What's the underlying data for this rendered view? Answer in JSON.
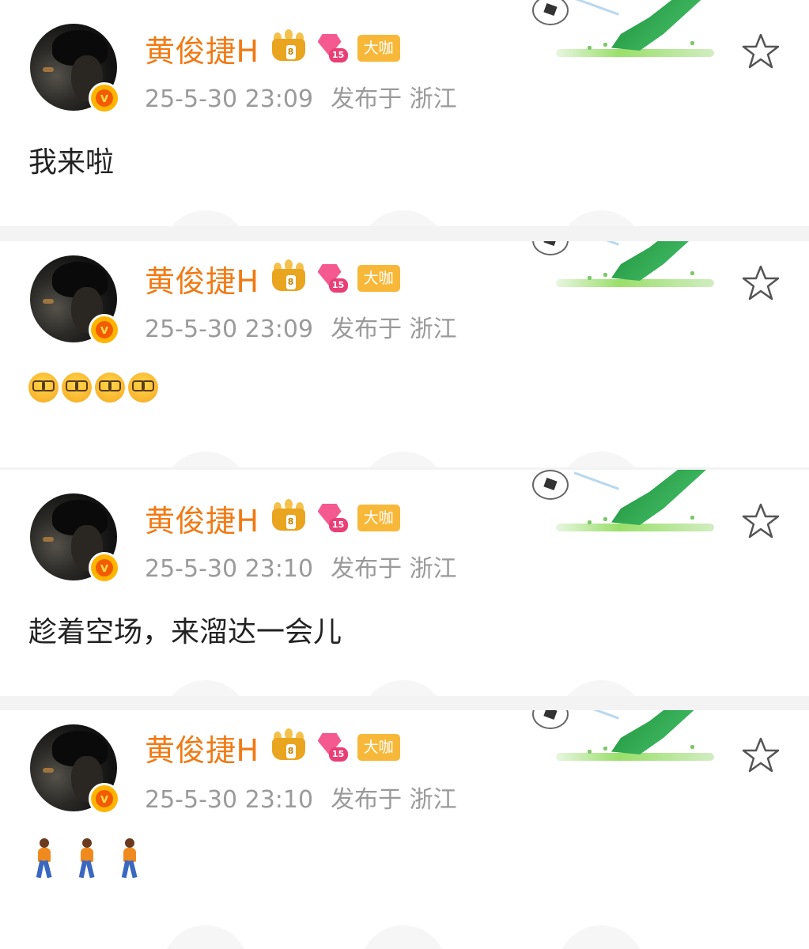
{
  "posts": [
    {
      "username": "黄俊捷H",
      "crown_level": "8",
      "diamond_level": "15",
      "badge": "大咖",
      "time": "25-5-30 23:09",
      "location": "发布于 浙江",
      "content": "我来啦",
      "content_type": "text"
    },
    {
      "username": "黄俊捷H",
      "crown_level": "8",
      "diamond_level": "15",
      "badge": "大咖",
      "time": "25-5-30 23:09",
      "location": "发布于 浙江",
      "content": "",
      "content_type": "emoji",
      "emoji_icons": [
        "nerd-face-icon",
        "nerd-face-icon",
        "nerd-face-icon",
        "nerd-face-icon"
      ]
    },
    {
      "username": "黄俊捷H",
      "crown_level": "8",
      "diamond_level": "15",
      "badge": "大咖",
      "time": "25-5-30 23:10",
      "location": "发布于 浙江",
      "content": "趁着空场，来溜达一会儿",
      "content_type": "text"
    },
    {
      "username": "黄俊捷H",
      "crown_level": "8",
      "diamond_level": "15",
      "badge": "大咖",
      "time": "25-5-30 23:10",
      "location": "发布于 浙江",
      "content": "",
      "content_type": "emoji",
      "emoji_icons": [
        "person-walking-icon",
        "person-walking-icon",
        "person-walking-icon"
      ]
    }
  ],
  "colors": {
    "username": "#f07a15",
    "meta": "#9a9a9a",
    "badge_bg": "#f7b83a",
    "verified": "#ffb400"
  }
}
